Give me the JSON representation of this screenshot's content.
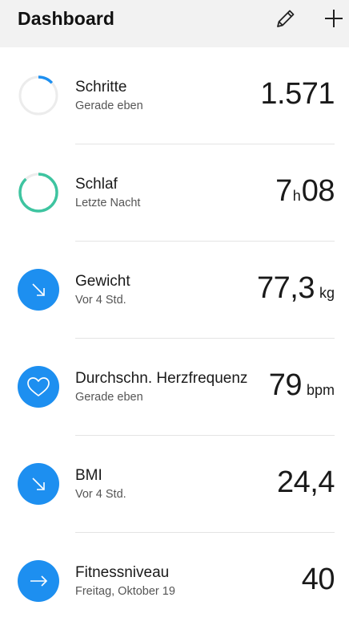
{
  "header": {
    "title": "Dashboard",
    "edit_icon": "pencil-icon",
    "add_icon": "plus-icon"
  },
  "colors": {
    "accent_blue": "#1d8ff0",
    "ring_green": "#3ec4a0",
    "ring_track": "#ececec",
    "header_bg": "#f2f2f2"
  },
  "items": [
    {
      "label": "Schritte",
      "sub": "Gerade eben",
      "value": "1.571",
      "unit": "",
      "icon": "progress-ring-icon",
      "progress": 0.13
    },
    {
      "label": "Schlaf",
      "sub": "Letzte Nacht",
      "value_hours": "7",
      "value_hours_unit": "h",
      "value_minutes": "08",
      "icon": "progress-ring-icon",
      "progress": 0.88
    },
    {
      "label": "Gewicht",
      "sub": "Vor 4 Std.",
      "value": "77,3",
      "unit": "kg",
      "icon": "trend-down-arrow-icon"
    },
    {
      "label": "Durchschn. Herzfrequenz",
      "sub": "Gerade eben",
      "value": "79",
      "unit": "bpm",
      "icon": "heart-icon"
    },
    {
      "label": "BMI",
      "sub": "Vor 4 Std.",
      "value": "24,4",
      "unit": "",
      "icon": "trend-down-arrow-icon"
    },
    {
      "label": "Fitnessniveau",
      "sub": "Freitag, Oktober 19",
      "value": "40",
      "unit": "",
      "icon": "trend-right-arrow-icon"
    }
  ]
}
